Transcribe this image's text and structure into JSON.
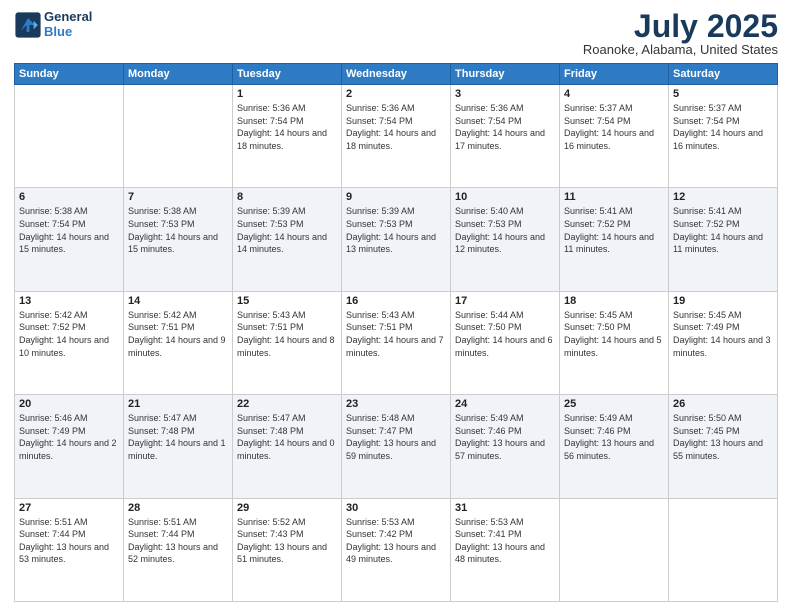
{
  "header": {
    "logo_line1": "General",
    "logo_line2": "Blue",
    "month": "July 2025",
    "location": "Roanoke, Alabama, United States"
  },
  "days_of_week": [
    "Sunday",
    "Monday",
    "Tuesday",
    "Wednesday",
    "Thursday",
    "Friday",
    "Saturday"
  ],
  "weeks": [
    [
      {
        "day": "",
        "sunrise": "",
        "sunset": "",
        "daylight": ""
      },
      {
        "day": "",
        "sunrise": "",
        "sunset": "",
        "daylight": ""
      },
      {
        "day": "1",
        "sunrise": "Sunrise: 5:36 AM",
        "sunset": "Sunset: 7:54 PM",
        "daylight": "Daylight: 14 hours and 18 minutes."
      },
      {
        "day": "2",
        "sunrise": "Sunrise: 5:36 AM",
        "sunset": "Sunset: 7:54 PM",
        "daylight": "Daylight: 14 hours and 18 minutes."
      },
      {
        "day": "3",
        "sunrise": "Sunrise: 5:36 AM",
        "sunset": "Sunset: 7:54 PM",
        "daylight": "Daylight: 14 hours and 17 minutes."
      },
      {
        "day": "4",
        "sunrise": "Sunrise: 5:37 AM",
        "sunset": "Sunset: 7:54 PM",
        "daylight": "Daylight: 14 hours and 16 minutes."
      },
      {
        "day": "5",
        "sunrise": "Sunrise: 5:37 AM",
        "sunset": "Sunset: 7:54 PM",
        "daylight": "Daylight: 14 hours and 16 minutes."
      }
    ],
    [
      {
        "day": "6",
        "sunrise": "Sunrise: 5:38 AM",
        "sunset": "Sunset: 7:54 PM",
        "daylight": "Daylight: 14 hours and 15 minutes."
      },
      {
        "day": "7",
        "sunrise": "Sunrise: 5:38 AM",
        "sunset": "Sunset: 7:53 PM",
        "daylight": "Daylight: 14 hours and 15 minutes."
      },
      {
        "day": "8",
        "sunrise": "Sunrise: 5:39 AM",
        "sunset": "Sunset: 7:53 PM",
        "daylight": "Daylight: 14 hours and 14 minutes."
      },
      {
        "day": "9",
        "sunrise": "Sunrise: 5:39 AM",
        "sunset": "Sunset: 7:53 PM",
        "daylight": "Daylight: 14 hours and 13 minutes."
      },
      {
        "day": "10",
        "sunrise": "Sunrise: 5:40 AM",
        "sunset": "Sunset: 7:53 PM",
        "daylight": "Daylight: 14 hours and 12 minutes."
      },
      {
        "day": "11",
        "sunrise": "Sunrise: 5:41 AM",
        "sunset": "Sunset: 7:52 PM",
        "daylight": "Daylight: 14 hours and 11 minutes."
      },
      {
        "day": "12",
        "sunrise": "Sunrise: 5:41 AM",
        "sunset": "Sunset: 7:52 PM",
        "daylight": "Daylight: 14 hours and 11 minutes."
      }
    ],
    [
      {
        "day": "13",
        "sunrise": "Sunrise: 5:42 AM",
        "sunset": "Sunset: 7:52 PM",
        "daylight": "Daylight: 14 hours and 10 minutes."
      },
      {
        "day": "14",
        "sunrise": "Sunrise: 5:42 AM",
        "sunset": "Sunset: 7:51 PM",
        "daylight": "Daylight: 14 hours and 9 minutes."
      },
      {
        "day": "15",
        "sunrise": "Sunrise: 5:43 AM",
        "sunset": "Sunset: 7:51 PM",
        "daylight": "Daylight: 14 hours and 8 minutes."
      },
      {
        "day": "16",
        "sunrise": "Sunrise: 5:43 AM",
        "sunset": "Sunset: 7:51 PM",
        "daylight": "Daylight: 14 hours and 7 minutes."
      },
      {
        "day": "17",
        "sunrise": "Sunrise: 5:44 AM",
        "sunset": "Sunset: 7:50 PM",
        "daylight": "Daylight: 14 hours and 6 minutes."
      },
      {
        "day": "18",
        "sunrise": "Sunrise: 5:45 AM",
        "sunset": "Sunset: 7:50 PM",
        "daylight": "Daylight: 14 hours and 5 minutes."
      },
      {
        "day": "19",
        "sunrise": "Sunrise: 5:45 AM",
        "sunset": "Sunset: 7:49 PM",
        "daylight": "Daylight: 14 hours and 3 minutes."
      }
    ],
    [
      {
        "day": "20",
        "sunrise": "Sunrise: 5:46 AM",
        "sunset": "Sunset: 7:49 PM",
        "daylight": "Daylight: 14 hours and 2 minutes."
      },
      {
        "day": "21",
        "sunrise": "Sunrise: 5:47 AM",
        "sunset": "Sunset: 7:48 PM",
        "daylight": "Daylight: 14 hours and 1 minute."
      },
      {
        "day": "22",
        "sunrise": "Sunrise: 5:47 AM",
        "sunset": "Sunset: 7:48 PM",
        "daylight": "Daylight: 14 hours and 0 minutes."
      },
      {
        "day": "23",
        "sunrise": "Sunrise: 5:48 AM",
        "sunset": "Sunset: 7:47 PM",
        "daylight": "Daylight: 13 hours and 59 minutes."
      },
      {
        "day": "24",
        "sunrise": "Sunrise: 5:49 AM",
        "sunset": "Sunset: 7:46 PM",
        "daylight": "Daylight: 13 hours and 57 minutes."
      },
      {
        "day": "25",
        "sunrise": "Sunrise: 5:49 AM",
        "sunset": "Sunset: 7:46 PM",
        "daylight": "Daylight: 13 hours and 56 minutes."
      },
      {
        "day": "26",
        "sunrise": "Sunrise: 5:50 AM",
        "sunset": "Sunset: 7:45 PM",
        "daylight": "Daylight: 13 hours and 55 minutes."
      }
    ],
    [
      {
        "day": "27",
        "sunrise": "Sunrise: 5:51 AM",
        "sunset": "Sunset: 7:44 PM",
        "daylight": "Daylight: 13 hours and 53 minutes."
      },
      {
        "day": "28",
        "sunrise": "Sunrise: 5:51 AM",
        "sunset": "Sunset: 7:44 PM",
        "daylight": "Daylight: 13 hours and 52 minutes."
      },
      {
        "day": "29",
        "sunrise": "Sunrise: 5:52 AM",
        "sunset": "Sunset: 7:43 PM",
        "daylight": "Daylight: 13 hours and 51 minutes."
      },
      {
        "day": "30",
        "sunrise": "Sunrise: 5:53 AM",
        "sunset": "Sunset: 7:42 PM",
        "daylight": "Daylight: 13 hours and 49 minutes."
      },
      {
        "day": "31",
        "sunrise": "Sunrise: 5:53 AM",
        "sunset": "Sunset: 7:41 PM",
        "daylight": "Daylight: 13 hours and 48 minutes."
      },
      {
        "day": "",
        "sunrise": "",
        "sunset": "",
        "daylight": ""
      },
      {
        "day": "",
        "sunrise": "",
        "sunset": "",
        "daylight": ""
      }
    ]
  ]
}
